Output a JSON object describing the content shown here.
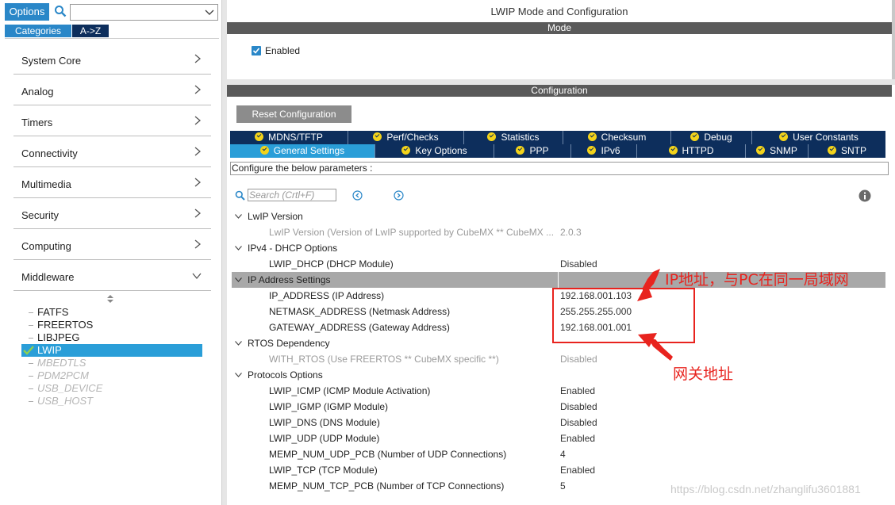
{
  "left": {
    "options_label": "Options",
    "search_value": "",
    "tabs": {
      "categories": "Categories",
      "az": "A->Z"
    },
    "categories": [
      {
        "label": "System Core"
      },
      {
        "label": "Analog"
      },
      {
        "label": "Timers"
      },
      {
        "label": "Connectivity"
      },
      {
        "label": "Multimedia"
      },
      {
        "label": "Security"
      },
      {
        "label": "Computing"
      },
      {
        "label": "Middleware"
      }
    ],
    "middleware_items": {
      "fatfs": "FATFS",
      "freertos": "FREERTOS",
      "libjpeg": "LIBJPEG",
      "lwip": "LWIP",
      "mbedtls": "MBEDTLS",
      "pdm2pcm": "PDM2PCM",
      "usb_device": "USB_DEVICE",
      "usb_host": "USB_HOST"
    }
  },
  "right": {
    "title": "LWIP Mode and Configuration",
    "mode_header": "Mode",
    "mode_enabled": "Enabled",
    "config_header": "Configuration",
    "reset_button": "Reset Configuration",
    "tabs_row1": [
      "MDNS/TFTP",
      "Perf/Checks",
      "Statistics",
      "Checksum",
      "Debug",
      "User Constants"
    ],
    "tabs_row2": [
      "General Settings",
      "Key Options",
      "PPP",
      "IPv6",
      "HTTPD",
      "SNMP",
      "SNTP"
    ],
    "active_tab": "General Settings",
    "describe": "Configure the below parameters :",
    "search_placeholder": "Search (Crtl+F)",
    "params": {
      "g1": "LwIP Version",
      "p1": {
        "name": "LwIP Version (Version of LwIP supported by CubeMX ** CubeMX ...",
        "value": "2.0.3"
      },
      "g2": "IPv4 - DHCP Options",
      "p2": {
        "name": "LWIP_DHCP (DHCP Module)",
        "value": "Disabled"
      },
      "g3": "IP Address Settings",
      "p3": {
        "name": "IP_ADDRESS (IP Address)",
        "value": "192.168.001.103"
      },
      "p4": {
        "name": "NETMASK_ADDRESS (Netmask Address)",
        "value": "255.255.255.000"
      },
      "p5": {
        "name": "GATEWAY_ADDRESS (Gateway Address)",
        "value": "192.168.001.001"
      },
      "g4": "RTOS Dependency",
      "p6": {
        "name": "WITH_RTOS (Use FREERTOS ** CubeMX specific **)",
        "value": "Disabled"
      },
      "g5": "Protocols Options",
      "p7": {
        "name": "LWIP_ICMP (ICMP Module Activation)",
        "value": "Enabled"
      },
      "p8": {
        "name": "LWIP_IGMP (IGMP Module)",
        "value": "Disabled"
      },
      "p9": {
        "name": "LWIP_DNS (DNS Module)",
        "value": "Disabled"
      },
      "p10": {
        "name": "LWIP_UDP (UDP Module)",
        "value": "Enabled"
      },
      "p11": {
        "name": "MEMP_NUM_UDP_PCB (Number of UDP Connections)",
        "value": "4"
      },
      "p12": {
        "name": "LWIP_TCP (TCP Module)",
        "value": "Enabled"
      },
      "p13": {
        "name": "MEMP_NUM_TCP_PCB (Number of TCP Connections)",
        "value": "5"
      }
    }
  },
  "annotations": {
    "ip_note": "IP地址，与PC在同一局域网",
    "gateway_note": "网关地址",
    "watermark": "https://blog.csdn.net/zhanglifu3601881",
    "color": "#e8231e"
  },
  "icons": {
    "search": "search-icon",
    "chevron_right": "chevron-right-icon",
    "chevron_down": "chevron-down-icon",
    "check": "check-icon",
    "info": "info-icon"
  }
}
